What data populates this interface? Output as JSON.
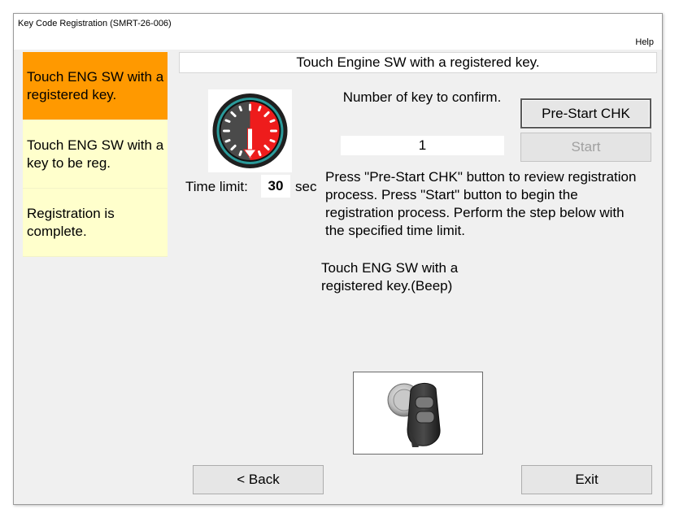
{
  "window": {
    "title": "Key Code Registration (SMRT-26-006)"
  },
  "menu": {
    "help": "Help"
  },
  "steps": [
    {
      "label": "Touch ENG SW with a registered key.",
      "active": true
    },
    {
      "label": "Touch ENG SW with a key to be reg.",
      "active": false
    },
    {
      "label": "Registration is complete.",
      "active": false
    }
  ],
  "header": {
    "text": "Touch Engine SW with a registered key."
  },
  "timer": {
    "label": "Time limit:",
    "value": "30",
    "unit": "sec",
    "icon": "timer-gauge-icon"
  },
  "keys": {
    "label": "Number of key to confirm.",
    "value": "1"
  },
  "buttons": {
    "prestart": "Pre-Start CHK",
    "start": "Start",
    "back": "< Back",
    "exit": "Exit"
  },
  "instructions": "Press \"Pre-Start CHK\" button to review registration process. Press \"Start\" button to begin the registration process. Perform the step below with the specified time limit.",
  "action": "Touch ENG SW with a registered key.(Beep)",
  "key_image": {
    "icon": "smart-key-touch-engine-switch-image"
  },
  "colors": {
    "active_step": "#ff9900",
    "inactive_step": "#ffffcc",
    "gauge_red": "#ee1c1c",
    "gauge_ring": "#2a9a9a"
  }
}
